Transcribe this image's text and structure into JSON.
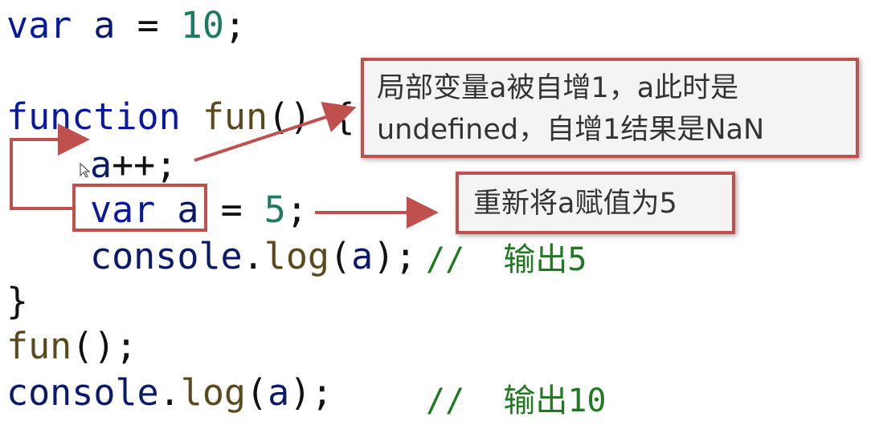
{
  "code": {
    "line1": {
      "kw": "var",
      "id": "a",
      "op": "=",
      "num": "10",
      "end": ";"
    },
    "line2": {
      "kw": "function",
      "fn": "fun",
      "paren": "()",
      "brace": "{"
    },
    "line3": {
      "id": "a",
      "op": "++;"
    },
    "line4": {
      "kw": "var",
      "id": "a",
      "op": "=",
      "num": "5",
      "end": ";"
    },
    "line5": {
      "obj": "console",
      "dot": ".",
      "fn": "log",
      "open": "(",
      "id": "a",
      "close": ");",
      "comment": "//  输出5"
    },
    "line6": {
      "brace": "}"
    },
    "line7": {
      "fn": "fun",
      "rest": "();"
    },
    "line8": {
      "obj": "console",
      "dot": ".",
      "fn": "log",
      "open": "(",
      "id": "a",
      "close": ");",
      "comment": "//  输出10"
    }
  },
  "annotations": {
    "callout1_line1": "局部变量a被自增1，a此时是",
    "callout1_line2": "undefined，自增1结果是NaN",
    "callout2": "重新将a赋值为5"
  },
  "colors": {
    "annotation_red": "#c0504d",
    "keyword_blue": "#0a1a9e",
    "function_brown": "#5c4a1e",
    "number_teal": "#1d7a63",
    "comment_green": "#1f7a1f"
  },
  "icons": [
    "mouse-cursor-icon"
  ]
}
